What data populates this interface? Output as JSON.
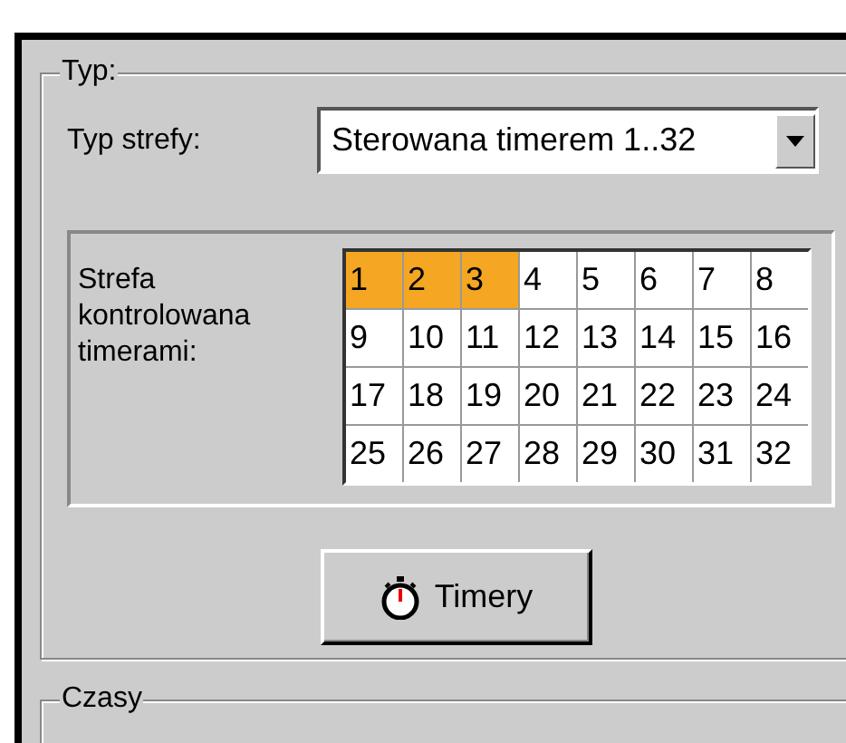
{
  "type_group": {
    "title": "Typ:",
    "zone_type": {
      "label": "Typ strefy:",
      "value": "Sterowana timerem 1..32"
    },
    "timer_zone": {
      "label": "Strefa kontrolowana timerami:",
      "cells": [
        {
          "label": "1",
          "selected": true
        },
        {
          "label": "2",
          "selected": true
        },
        {
          "label": "3",
          "selected": true
        },
        {
          "label": "4",
          "selected": false
        },
        {
          "label": "5",
          "selected": false
        },
        {
          "label": "6",
          "selected": false
        },
        {
          "label": "7",
          "selected": false
        },
        {
          "label": "8",
          "selected": false
        },
        {
          "label": "9",
          "selected": false
        },
        {
          "label": "10",
          "selected": false
        },
        {
          "label": "11",
          "selected": false
        },
        {
          "label": "12",
          "selected": false
        },
        {
          "label": "13",
          "selected": false
        },
        {
          "label": "14",
          "selected": false
        },
        {
          "label": "15",
          "selected": false
        },
        {
          "label": "16",
          "selected": false
        },
        {
          "label": "17",
          "selected": false
        },
        {
          "label": "18",
          "selected": false
        },
        {
          "label": "19",
          "selected": false
        },
        {
          "label": "20",
          "selected": false
        },
        {
          "label": "21",
          "selected": false
        },
        {
          "label": "22",
          "selected": false
        },
        {
          "label": "23",
          "selected": false
        },
        {
          "label": "24",
          "selected": false
        },
        {
          "label": "25",
          "selected": false
        },
        {
          "label": "26",
          "selected": false
        },
        {
          "label": "27",
          "selected": false
        },
        {
          "label": "28",
          "selected": false
        },
        {
          "label": "29",
          "selected": false
        },
        {
          "label": "30",
          "selected": false
        },
        {
          "label": "31",
          "selected": false
        },
        {
          "label": "32",
          "selected": false
        }
      ]
    },
    "button": "Timery"
  },
  "times_group": {
    "title": "Czasy"
  }
}
